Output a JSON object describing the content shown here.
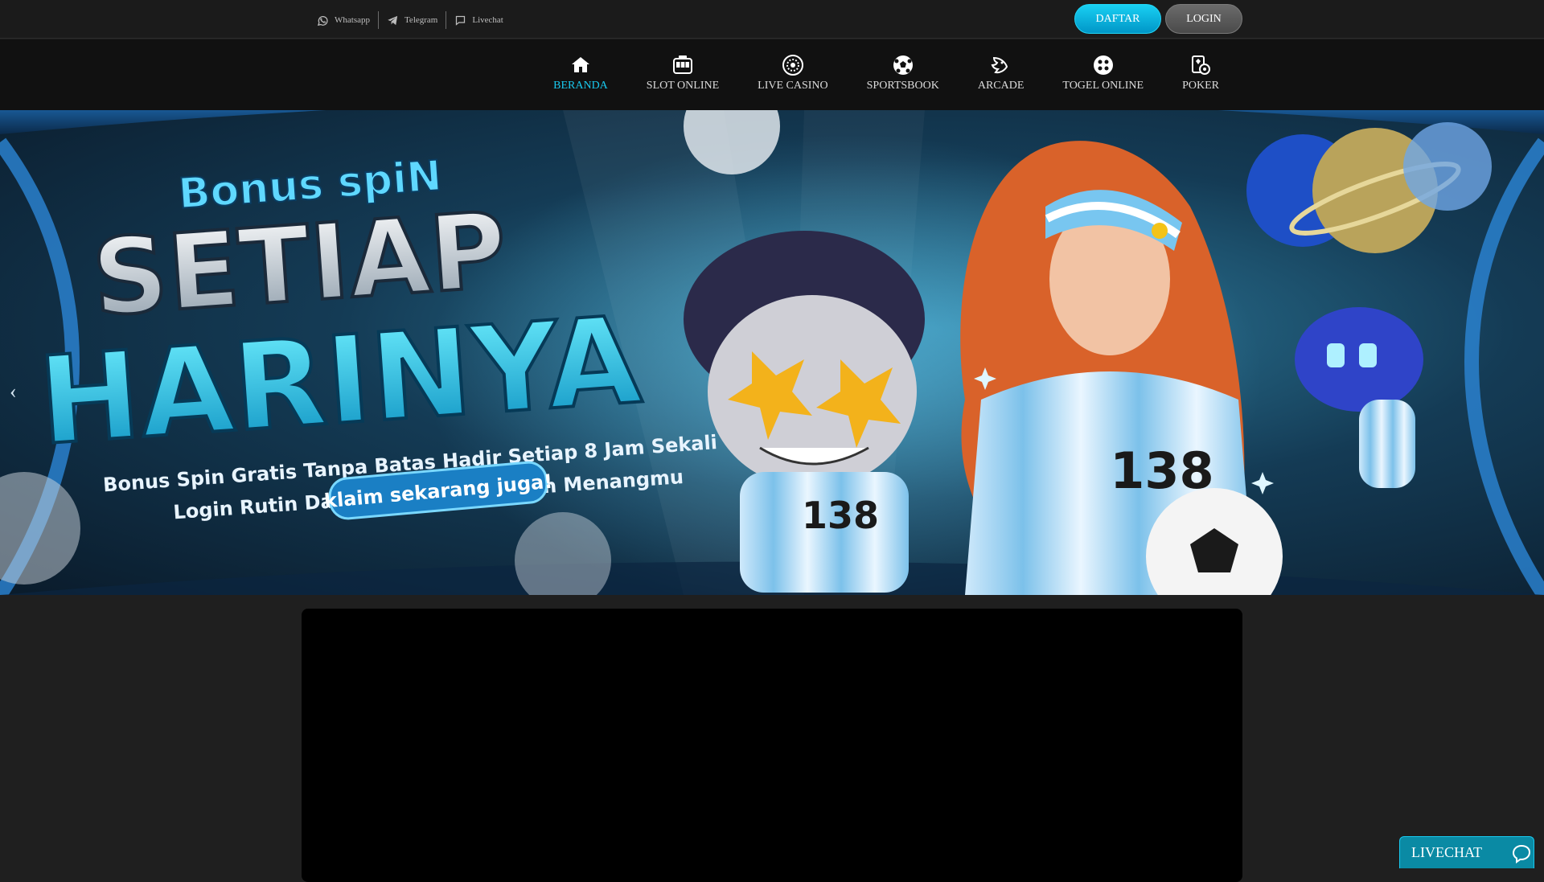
{
  "topbar": {
    "contacts": [
      {
        "label": "Whatsapp",
        "icon": "whatsapp-icon"
      },
      {
        "label": "Telegram",
        "icon": "telegram-icon"
      },
      {
        "label": "Livechat",
        "icon": "chat-icon"
      }
    ],
    "daftar_label": "DAFTAR",
    "login_label": "LOGIN"
  },
  "nav": {
    "items": [
      {
        "label": "BERANDA",
        "icon": "home-icon",
        "active": true
      },
      {
        "label": "SLOT ONLINE",
        "icon": "slot-machine-icon"
      },
      {
        "label": "LIVE CASINO",
        "icon": "roulette-icon"
      },
      {
        "label": "SPORTSBOOK",
        "icon": "soccer-ball-icon"
      },
      {
        "label": "ARCADE",
        "icon": "fish-icon"
      },
      {
        "label": "TOGEL ONLINE",
        "icon": "lottery-ball-icon"
      },
      {
        "label": "POKER",
        "icon": "poker-cards-icon"
      }
    ]
  },
  "banner": {
    "line1": "Bonus spiN",
    "line2": "SETIAP",
    "line3": "HARINYA",
    "sub1": "Bonus Spin Gratis Tanpa Batas Hadir Setiap 8 Jam Sekali",
    "sub2": "Login Rutin Dan Klaim Kesempatan Menangmu",
    "cta": "klaim sekarang juga!",
    "jersey_number": "138"
  },
  "livechat": {
    "label": "LIVECHAT"
  },
  "colors": {
    "accent": "#19c9ef",
    "background": "#1f1f1f",
    "navbar": "#111111"
  }
}
